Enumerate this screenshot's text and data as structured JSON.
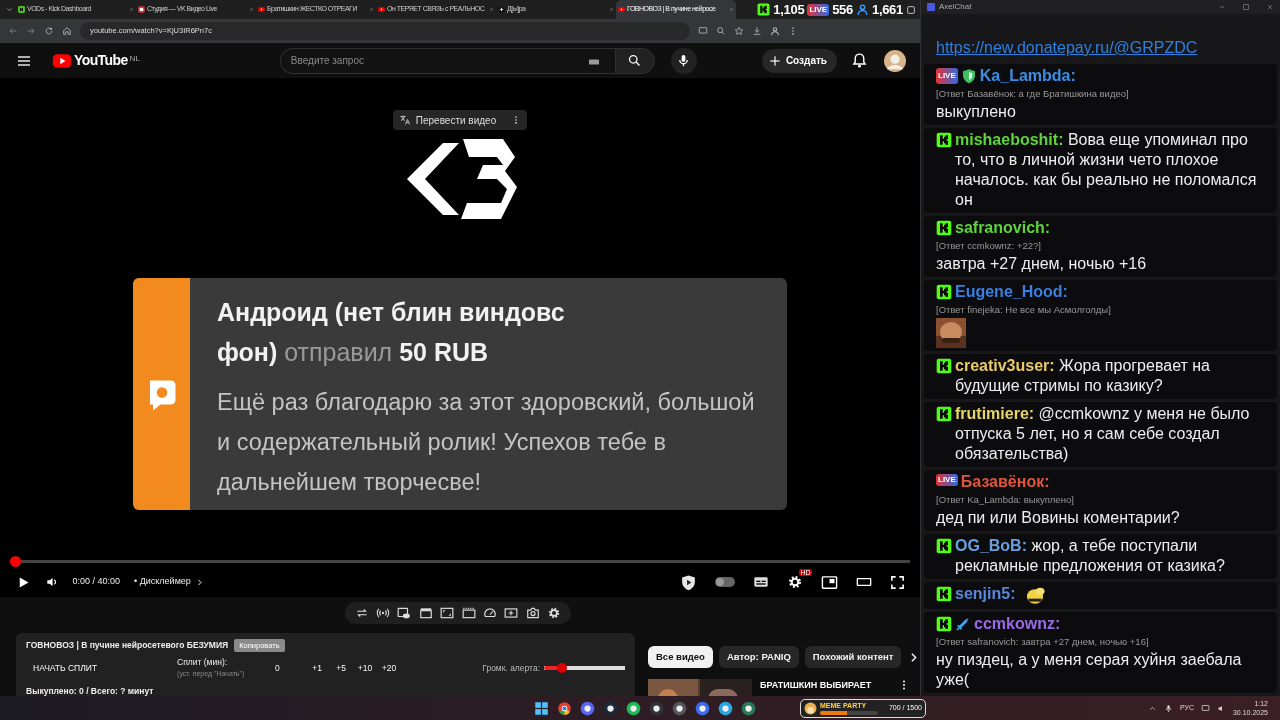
{
  "browser": {
    "tabs": [
      {
        "kind": "kick",
        "title": "VODs - Kick Dashboard",
        "selected": false
      },
      {
        "kind": "vk",
        "title": "Студия — VK Видео Live",
        "selected": false
      },
      {
        "kind": "youtube",
        "title": "Братишкин ЖЕСТКО ОТРЕАГИ",
        "selected": false
      },
      {
        "kind": "youtube",
        "title": "Он ТЕРЯЕТ СВЯЗЬ с РЕАЛЬНОС",
        "selected": false
      },
      {
        "kind": "dzen",
        "title": "Д[ы]ра",
        "selected": false
      },
      {
        "kind": "youtube",
        "title": "ГОВНОВОЗ | В пучине нейросе",
        "selected": true
      }
    ],
    "address": "youtube.com/watch?v=KjU3IR6Pn7c"
  },
  "stream_stats": [
    {
      "kind": "kick",
      "value": "1,105"
    },
    {
      "kind": "vk",
      "label": "LIVE",
      "value": "556"
    },
    {
      "kind": "viewers",
      "value": "1,661"
    }
  ],
  "youtube": {
    "logo_text": "YouTube",
    "region": "NL",
    "search": {
      "placeholder": "Введите запрос"
    },
    "create_button": "Создать"
  },
  "video": {
    "translate_button": "Перевести видео",
    "donation": {
      "sender": "Андроид (нет блин виндовс фон)",
      "action": "отправил",
      "amount": "50 RUB",
      "message": "Ещё раз благодарю за этот здоровский, большой и содержательный ролик! Успехов тебе в дальнейшем творчесве!"
    },
    "progress": {
      "level": 0
    },
    "time": "0:00 / 40:00",
    "chapter": "• Дисклеймер",
    "autoplay": {
      "on": false
    },
    "quality_badge": "HD"
  },
  "panel": {
    "title": "ГОВНОВОЗ | В пучине нейросетевого БЕЗУМИЯ",
    "copy_button": "Копировать",
    "split_button": "НАЧАТЬ СПЛИТ",
    "split_label": "Сплит (мин):",
    "split_hint": "(уст. перед \"Начать\")",
    "split_value": "0",
    "increments": [
      "+1",
      "+5",
      "+10",
      "+20"
    ],
    "volume_label": "Громк. алерта:",
    "volume": {
      "level": 0.19
    },
    "status": "Выкуплено: 0 / Всего: ? минут"
  },
  "chips": [
    {
      "label": "Все видео",
      "selected": true
    },
    {
      "label": "Автор: PANIQ",
      "selected": false
    },
    {
      "label": "Похожий контент",
      "selected": false
    }
  ],
  "recommended": [
    {
      "title": "БРАТИШКИН ВЫБИРАЕТ"
    }
  ],
  "chat": {
    "title": "AxelChat",
    "messages": [
      {
        "kind": "link",
        "text": "https://new.donatepay.ru/@GRPZDC"
      },
      {
        "kind": "text",
        "badges": [
          {
            "kind": "vk",
            "label": "LIVE"
          },
          {
            "kind": "moderator"
          }
        ],
        "author": "Ka_Lambda:",
        "color": "#3b8ee6",
        "reply": "[Ответ Базавёнок: а где Братишкина видео]",
        "text": "выкуплено"
      },
      {
        "kind": "text",
        "badges": [
          {
            "kind": "kick"
          }
        ],
        "author": "mishaeboshit:",
        "color": "#5fd33a",
        "text": "Вова еще упоминал про то, что в личной жизни чето плохое началось. как бы реально не поломался он"
      },
      {
        "kind": "text",
        "badges": [
          {
            "kind": "kick"
          }
        ],
        "author": "safranovich:",
        "color": "#5fd33a",
        "reply": "[Ответ ccmkownz: +22?]",
        "text": "завтра +27 днем, ночью +16"
      },
      {
        "kind": "emote",
        "badges": [
          {
            "kind": "kick"
          }
        ],
        "author": "Eugene_Hood:",
        "color": "#3b7fe0",
        "reply": "[Ответ finejeka: Не все мы Асмолголды]"
      },
      {
        "kind": "text",
        "badges": [
          {
            "kind": "kick"
          }
        ],
        "author": "creativ3user:",
        "color": "#e8c96a",
        "text": "Жора прогревает на будущие стримы по казику?"
      },
      {
        "kind": "text",
        "badges": [
          {
            "kind": "kick"
          }
        ],
        "author": "frutimiere:",
        "color": "#e6d66a",
        "text": "@ccmkownz у меня не было отпуска 5 лет, но я сам себе создал обязательства)"
      },
      {
        "kind": "text",
        "badges": [
          {
            "kind": "vk",
            "label": "LIVE"
          }
        ],
        "author": "Базавёнок:",
        "color": "#e0553c",
        "reply": "[Ответ Ka_Lambda: выкуплено]",
        "text": "дед пи или Вовины коментарии?"
      },
      {
        "kind": "text",
        "badges": [
          {
            "kind": "kick"
          }
        ],
        "author": "OG_BoB:",
        "color": "#6a9fe0",
        "text": "жор, а тебе поступали рекламные предложения от казика?"
      },
      {
        "kind": "emote",
        "badges": [
          {
            "kind": "kick"
          }
        ],
        "author": "senjin5:",
        "color": "#5a86d8"
      },
      {
        "kind": "text",
        "badges": [
          {
            "kind": "kick"
          },
          {
            "kind": "sword"
          }
        ],
        "author": "ccmkownz:",
        "color": "#9a6ae6",
        "reply": "[Ответ safranovich: завтра +27 днем, ночью +16]",
        "text": "ну пиздец, а у меня серая хуйня заебала уже("
      }
    ]
  },
  "taskbar": {
    "widget": {
      "title": "MEME PARTY",
      "reading": "700 / 1500",
      "level": 0.47
    },
    "language": "РУС",
    "time": "1:12",
    "date": "30.10.2025"
  }
}
